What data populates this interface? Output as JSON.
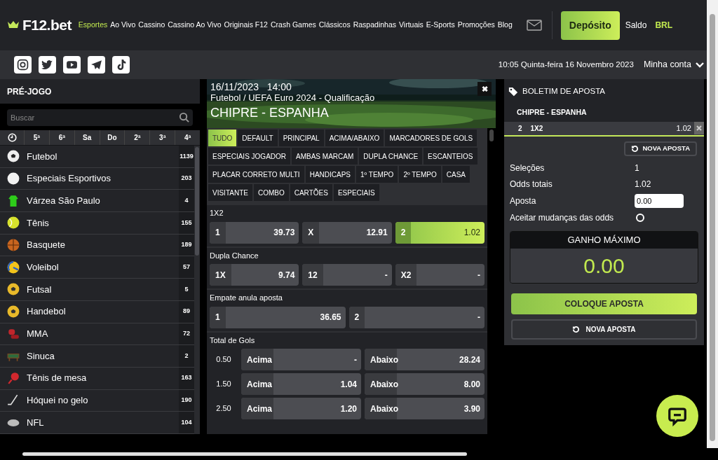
{
  "header": {
    "logo": "F12.bet",
    "nav": [
      {
        "label": "Esportes",
        "selected": true
      },
      {
        "label": "Ao Vivo",
        "selected": false
      },
      {
        "label": "Cassino",
        "selected": false
      },
      {
        "label": "Cassino Ao Vivo",
        "selected": false
      },
      {
        "label": "Originais F12",
        "selected": false
      },
      {
        "label": "Crash Games",
        "selected": false
      },
      {
        "label": "Clássicos",
        "selected": false
      },
      {
        "label": "Raspadinhas",
        "selected": false
      },
      {
        "label": "Virtuais",
        "selected": false
      },
      {
        "label": "E-Sports",
        "selected": false
      },
      {
        "label": "Promoções",
        "selected": false
      },
      {
        "label": "Blog",
        "selected": false
      }
    ],
    "deposit": "Depósito",
    "balance_label": "Saldo",
    "currency": "BRL"
  },
  "subbar": {
    "datetime": "10:05 Quinta-feira 16 Novembro 2023",
    "account": "Minha conta"
  },
  "sidebar": {
    "title": "PRÉ-JOGO",
    "search": {
      "placeholder": "Buscar"
    },
    "days": [
      "5ª",
      "6ª",
      "Sa",
      "Do",
      "2ª",
      "3ª",
      "4ª"
    ],
    "sports": [
      {
        "name": "Futebol",
        "count": "1139"
      },
      {
        "name": "Especiais Esportivos",
        "count": "203"
      },
      {
        "name": "Várzea São Paulo",
        "count": "4"
      },
      {
        "name": "Tênis",
        "count": "155"
      },
      {
        "name": "Basquete",
        "count": "189"
      },
      {
        "name": "Voleibol",
        "count": "57"
      },
      {
        "name": "Futsal",
        "count": "5"
      },
      {
        "name": "Handebol",
        "count": "89"
      },
      {
        "name": "MMA",
        "count": "72"
      },
      {
        "name": "Sinuca",
        "count": "2"
      },
      {
        "name": "Tênis de mesa",
        "count": "163"
      },
      {
        "name": "Hóquei no gelo",
        "count": "190"
      },
      {
        "name": "NFL",
        "count": "104"
      }
    ]
  },
  "event": {
    "date": "16/11/2023",
    "time": "14:00",
    "league": "Futebol / UEFA Euro 2024 - Qualificação",
    "teams": "CHIPRE - ESPANHA",
    "close": "✖"
  },
  "market_tabs": [
    {
      "label": "TUDO",
      "selected": true
    },
    {
      "label": "DEFAULT",
      "selected": false
    },
    {
      "label": "PRINCIPAL",
      "selected": false
    },
    {
      "label": "ACIMA/ABAIXO",
      "selected": false
    },
    {
      "label": "MARCADORES DE GOLS",
      "selected": false
    },
    {
      "label": "ESPECIAIS JOGADOR",
      "selected": false
    },
    {
      "label": "AMBAS MARCAM",
      "selected": false
    },
    {
      "label": "DUPLA CHANCE",
      "selected": false
    },
    {
      "label": "ESCANTEIOS",
      "selected": false
    },
    {
      "label": "PLACAR CORRETO MULTI",
      "selected": false
    },
    {
      "label": "HANDICAPS",
      "selected": false
    },
    {
      "label": "1º TEMPO",
      "selected": false
    },
    {
      "label": "2º TEMPO",
      "selected": false
    },
    {
      "label": "CASA",
      "selected": false
    },
    {
      "label": "VISITANTE",
      "selected": false
    },
    {
      "label": "COMBO",
      "selected": false
    },
    {
      "label": "CARTÕES",
      "selected": false
    },
    {
      "label": "ESPECIAIS",
      "selected": false
    }
  ],
  "markets": [
    {
      "title": "1X2",
      "kind": "outcomes",
      "outcomes": [
        {
          "label": "1",
          "odds": "39.73",
          "selected": false
        },
        {
          "label": "X",
          "odds": "12.91",
          "selected": false
        },
        {
          "label": "2",
          "odds": "1.02",
          "selected": true
        }
      ]
    },
    {
      "title": "Dupla Chance",
      "kind": "outcomes",
      "outcomes": [
        {
          "label": "1X",
          "odds": "9.74",
          "selected": false
        },
        {
          "label": "12",
          "odds": "-",
          "selected": false
        },
        {
          "label": "X2",
          "odds": "-",
          "selected": false
        }
      ]
    },
    {
      "title": "Empate anula aposta",
      "kind": "outcomes",
      "outcomes": [
        {
          "label": "1",
          "odds": "36.65",
          "selected": false
        },
        {
          "label": "2",
          "odds": "-",
          "selected": false
        }
      ]
    },
    {
      "title": "Total de Gols",
      "kind": "lines",
      "lines": [
        {
          "line": "0.50",
          "over": {
            "label": "Acima",
            "odds": "-"
          },
          "under": {
            "label": "Abaixo",
            "odds": "28.24"
          }
        },
        {
          "line": "1.50",
          "over": {
            "label": "Acima",
            "odds": "1.04"
          },
          "under": {
            "label": "Abaixo",
            "odds": "8.00"
          }
        },
        {
          "line": "2.50",
          "over": {
            "label": "Acima",
            "odds": "1.20"
          },
          "under": {
            "label": "Abaixo",
            "odds": "3.90"
          }
        }
      ]
    }
  ],
  "betslip": {
    "title": "BOLETIM DE APOSTA",
    "event": "CHIPRE - ESPANHA",
    "selection": {
      "pick": "2",
      "market": "1X2",
      "odds": "1.02"
    },
    "new_bet_top": "NOVA APOSTA",
    "summary": [
      {
        "label": "Seleções",
        "value": "1"
      },
      {
        "label": "Odds totais",
        "value": "1.02"
      }
    ],
    "stake": {
      "label": "Aposta",
      "value": "0.00"
    },
    "accept_changes": {
      "label": "Aceitar mudanças das odds",
      "checked": false
    },
    "max_win": {
      "title": "GANHO MÁXIMO",
      "value": "0.00"
    },
    "place_bet": "COLOQUE APOSTA",
    "new_bet_bottom": "NOVA APOSTA"
  }
}
